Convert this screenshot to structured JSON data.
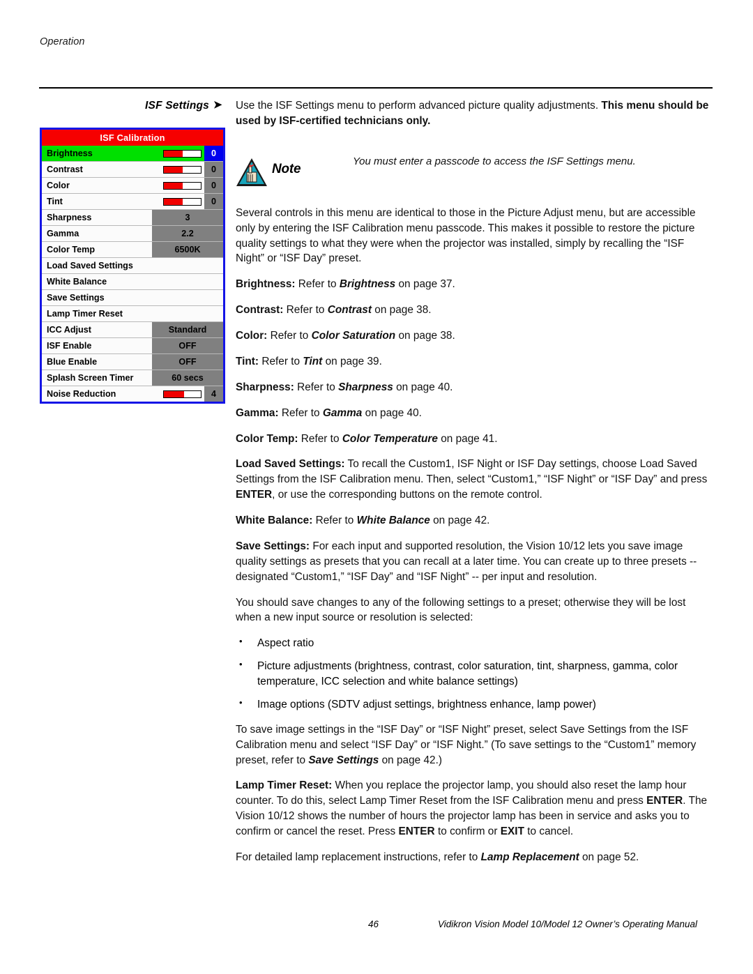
{
  "header": {
    "running_head": "Operation"
  },
  "side_heading": {
    "label": "ISF Settings",
    "arrow": "➤"
  },
  "intro": {
    "plain1": "Use the ISF Settings menu to perform advanced picture quality adjustments. ",
    "bold1": "This menu should be used by ISF-certified technicians only."
  },
  "note": {
    "icon": "note-hand-reminder-icon",
    "label": "Note",
    "text": "You must enter a passcode to access the ISF Settings menu."
  },
  "paragraphs": {
    "several_controls": "Several controls in this menu are identical to those in the Picture Adjust menu, but are accessible only by entering the ISF Calibration menu passcode. This makes it possible to restore the picture quality settings to what they were when the projector was installed, simply by recalling the “ISF Night” or “ISF Day” preset.",
    "save_settings_bold": "Save Settings:",
    "save_settings_rest": " For each input and supported resolution, the Vision 10/12 lets you save image quality settings as presets that you can recall at a later time. You can create up to three presets -- designated “Custom1,” “ISF Day” and “ISF Night” -- per input and resolution.",
    "you_should_save": "You should save changes to any of the following settings to a preset; otherwise they will be lost when a new input source or resolution is selected:",
    "to_save_image_a": "To save image settings in the “ISF Day” or “ISF Night” preset, select Save Settings from the ISF Calibration menu and select “ISF Day” or “ISF Night.” (To save settings to the “Custom1” memory preset, refer to ",
    "to_save_image_ref": "Save Settings",
    "to_save_image_b": " on page 42.)",
    "load_saved_bold": "Load Saved Settings:",
    "load_saved_a": " To recall the Custom1, ISF Night or ISF Day settings, choose Load Saved Settings from the ISF Calibration menu. Then, select “Custom1,” “ISF Night” or “ISF Day” and press ",
    "load_saved_enter": "ENTER",
    "load_saved_b": ", or use the corresponding buttons on the remote control.",
    "lamp_timer_bold": "Lamp Timer Reset:",
    "lamp_timer_a": " When you replace the projector lamp, you should also reset the lamp hour counter. To do this, select Lamp Timer Reset from the ISF Calibration menu and press ",
    "lamp_timer_enter1": "ENTER",
    "lamp_timer_b": ". The Vision 10/12 shows the number of hours the projector lamp has been in service and asks you to confirm or cancel the reset. Press ",
    "lamp_timer_enter2": "ENTER",
    "lamp_timer_c": " to confirm or ",
    "lamp_timer_exit": "EXIT",
    "lamp_timer_d": " to cancel.",
    "lamp_replace_a": "For detailed lamp replacement instructions, refer to ",
    "lamp_replace_ref": "Lamp Replacement",
    "lamp_replace_b": " on page 52."
  },
  "refer_lines": [
    {
      "term": "Brightness:",
      "mid": " Refer to ",
      "ref": "Brightness",
      "tail": " on page 37."
    },
    {
      "term": "Contrast:",
      "mid": " Refer to ",
      "ref": "Contrast",
      "tail": " on page 38."
    },
    {
      "term": "Color:",
      "mid": " Refer to ",
      "ref": "Color Saturation",
      "tail": " on page 38."
    },
    {
      "term": "Tint:",
      "mid": " Refer to ",
      "ref": "Tint",
      "tail": " on page 39."
    },
    {
      "term": "Sharpness:",
      "mid": " Refer to ",
      "ref": "Sharpness",
      "tail": " on page 40."
    },
    {
      "term": "Gamma:",
      "mid": " Refer to ",
      "ref": "Gamma",
      "tail": " on page 40."
    },
    {
      "term": "Color Temp:",
      "mid": " Refer to ",
      "ref": "Color Temperature",
      "tail": " on page 41."
    },
    {
      "term": "White Balance:",
      "mid": " Refer to ",
      "ref": "White Balance",
      "tail": " on page 42."
    }
  ],
  "bullets": [
    "Aspect ratio",
    "Picture adjustments (brightness, contrast, color saturation, tint, sharpness, gamma, color temperature, ICC selection and white balance settings)",
    "Image options (SDTV adjust settings, brightness enhance, lamp power)"
  ],
  "osd": {
    "title": "ISF Calibration",
    "colors": {
      "border": "#1414e6",
      "title_bar": "#f60000",
      "selected_row": "#00e000",
      "selected_value": "#0000ee",
      "value_cell": "#808080",
      "slider_fill": "#f00000"
    },
    "rows": [
      {
        "label": "Brightness",
        "type": "slider",
        "value": "0",
        "fill_pct": 50,
        "selected": true
      },
      {
        "label": "Contrast",
        "type": "slider",
        "value": "0",
        "fill_pct": 50,
        "selected": false
      },
      {
        "label": "Color",
        "type": "slider",
        "value": "0",
        "fill_pct": 50,
        "selected": false
      },
      {
        "label": "Tint",
        "type": "slider",
        "value": "0",
        "fill_pct": 50,
        "selected": false
      },
      {
        "label": "Sharpness",
        "type": "value",
        "value": "3",
        "selected": false
      },
      {
        "label": "Gamma",
        "type": "value",
        "value": "2.2",
        "selected": false
      },
      {
        "label": "Color Temp",
        "type": "value",
        "value": "6500K",
        "selected": false
      },
      {
        "label": "Load Saved Settings",
        "type": "submenu",
        "value": "",
        "selected": false
      },
      {
        "label": "White Balance",
        "type": "submenu",
        "value": "",
        "selected": false
      },
      {
        "label": "Save Settings",
        "type": "submenu",
        "value": "",
        "selected": false
      },
      {
        "label": "Lamp Timer Reset",
        "type": "submenu",
        "value": "",
        "selected": false
      },
      {
        "label": "ICC Adjust",
        "type": "value",
        "value": "Standard",
        "selected": false
      },
      {
        "label": "ISF Enable",
        "type": "value",
        "value": "OFF",
        "selected": false
      },
      {
        "label": "Blue Enable",
        "type": "value",
        "value": "OFF",
        "selected": false
      },
      {
        "label": "Splash Screen Timer",
        "type": "value",
        "value": "60 secs",
        "selected": false
      },
      {
        "label": "Noise Reduction",
        "type": "slider",
        "value": "4",
        "fill_pct": 55,
        "selected": false
      }
    ]
  },
  "footer": {
    "page_number": "46",
    "manual_title": "Vidikron Vision Model 10/Model 12 Owner’s Operating Manual"
  }
}
